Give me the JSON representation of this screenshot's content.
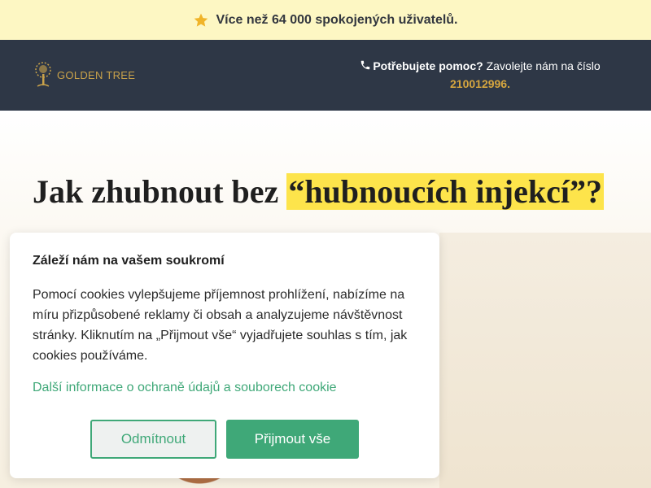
{
  "promo": {
    "icon": "star-icon",
    "text": "Více než 64 000 spokojených uživatelů."
  },
  "header": {
    "logo_text": "GOLDEN TREE",
    "help_prefix": "Potřebujete pomoc?",
    "help_text": " Zavolejte nám na číslo",
    "phone_number": "210012996.",
    "phone_icon": "phone-icon"
  },
  "hero": {
    "title_plain": "Jak zhubnout bez ",
    "title_highlight": "“hubnoucích injekcí”?"
  },
  "cookie_banner": {
    "title": "Záleží nám na vašem soukromí",
    "body": "Pomocí cookies vylepšujeme příjemnost prohlížení, nabízíme na míru přizpůsobené reklamy či obsah a analyzujeme návštěvnost stránky. Kliknutím na „Přijmout vše“ vyjadřujete souhlas s tím, jak cookies používáme.",
    "link": "Další informace o ochraně údajů a souborech cookie",
    "reject_label": "Odmítnout",
    "accept_label": "Přijmout vše"
  },
  "colors": {
    "promo_bg": "#fdf7c3",
    "header_bg": "#2e3746",
    "accent_gold": "#d6a63f",
    "highlight_yellow": "#fde44b",
    "brand_green": "#3fa878"
  }
}
